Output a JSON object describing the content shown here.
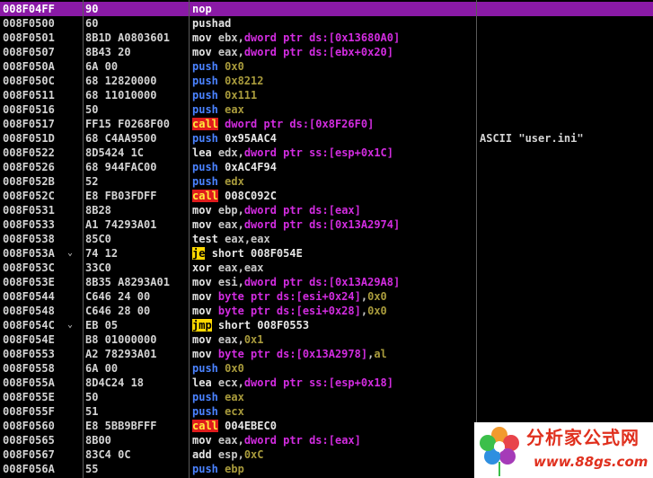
{
  "rows": [
    {
      "addr": "008F04FF",
      "jm": "",
      "hex": "90",
      "dis": [
        [
          "mn",
          "nop"
        ]
      ],
      "comment": "",
      "selected": true
    },
    {
      "addr": "008F0500",
      "jm": "",
      "hex": "60",
      "dis": [
        [
          "mn",
          "pushad"
        ]
      ],
      "comment": ""
    },
    {
      "addr": "008F0501",
      "jm": "",
      "hex": "8B1D A0803601",
      "dis": [
        [
          "mn",
          "mov "
        ],
        [
          "reg",
          "ebx"
        ],
        [
          "sep",
          ","
        ],
        [
          "mem",
          "dword ptr ds:[0x13680A0]"
        ]
      ],
      "comment": ""
    },
    {
      "addr": "008F0507",
      "jm": "",
      "hex": "8B43 20",
      "dis": [
        [
          "mn",
          "mov "
        ],
        [
          "reg",
          "eax"
        ],
        [
          "sep",
          ","
        ],
        [
          "mem",
          "dword ptr ds:[ebx+0x20]"
        ]
      ],
      "comment": ""
    },
    {
      "addr": "008F050A",
      "jm": "",
      "hex": "6A 00",
      "dis": [
        [
          "push",
          "push "
        ],
        [
          "num",
          "0x0"
        ]
      ],
      "comment": ""
    },
    {
      "addr": "008F050C",
      "jm": "",
      "hex": "68 12820000",
      "dis": [
        [
          "push",
          "push "
        ],
        [
          "num",
          "0x8212"
        ]
      ],
      "comment": ""
    },
    {
      "addr": "008F0511",
      "jm": "",
      "hex": "68 11010000",
      "dis": [
        [
          "push",
          "push "
        ],
        [
          "num",
          "0x111"
        ]
      ],
      "comment": ""
    },
    {
      "addr": "008F0516",
      "jm": "",
      "hex": "50",
      "dis": [
        [
          "push",
          "push "
        ],
        [
          "num",
          "eax"
        ]
      ],
      "comment": ""
    },
    {
      "addr": "008F0517",
      "jm": "",
      "hex": "FF15 F0268F00",
      "dis": [
        [
          "call",
          "call"
        ],
        [
          "sep",
          " "
        ],
        [
          "mem",
          "dword ptr ds:[0x8F26F0]"
        ]
      ],
      "comment": ""
    },
    {
      "addr": "008F051D",
      "jm": "",
      "hex": "68 C4AA9500",
      "dis": [
        [
          "push",
          "push "
        ],
        [
          "lbl",
          "0x95AAC4"
        ]
      ],
      "comment": "ASCII \"user.ini\""
    },
    {
      "addr": "008F0522",
      "jm": "",
      "hex": "8D5424 1C",
      "dis": [
        [
          "mn",
          "lea "
        ],
        [
          "reg",
          "edx"
        ],
        [
          "sep",
          ","
        ],
        [
          "mem",
          "dword ptr ss:[esp+0x1C]"
        ]
      ],
      "comment": ""
    },
    {
      "addr": "008F0526",
      "jm": "",
      "hex": "68 944FAC00",
      "dis": [
        [
          "push",
          "push "
        ],
        [
          "lbl",
          "0xAC4F94"
        ]
      ],
      "comment": ""
    },
    {
      "addr": "008F052B",
      "jm": "",
      "hex": "52",
      "dis": [
        [
          "push",
          "push "
        ],
        [
          "num",
          "edx"
        ]
      ],
      "comment": ""
    },
    {
      "addr": "008F052C",
      "jm": "",
      "hex": "E8 FB03FDFF",
      "dis": [
        [
          "call",
          "call"
        ],
        [
          "sep",
          " "
        ],
        [
          "lbl",
          "008C092C"
        ]
      ],
      "comment": ""
    },
    {
      "addr": "008F0531",
      "jm": "",
      "hex": "8B28",
      "dis": [
        [
          "mn",
          "mov "
        ],
        [
          "reg",
          "ebp"
        ],
        [
          "sep",
          ","
        ],
        [
          "mem",
          "dword ptr ds:[eax]"
        ]
      ],
      "comment": ""
    },
    {
      "addr": "008F0533",
      "jm": "",
      "hex": "A1 74293A01",
      "dis": [
        [
          "mn",
          "mov "
        ],
        [
          "reg",
          "eax"
        ],
        [
          "sep",
          ","
        ],
        [
          "mem",
          "dword ptr ds:[0x13A2974]"
        ]
      ],
      "comment": ""
    },
    {
      "addr": "008F0538",
      "jm": "",
      "hex": "85C0",
      "dis": [
        [
          "mn",
          "test "
        ],
        [
          "reg",
          "eax"
        ],
        [
          "sep",
          ","
        ],
        [
          "reg",
          "eax"
        ]
      ],
      "comment": ""
    },
    {
      "addr": "008F053A",
      "jm": "⌄",
      "hex": "74 12",
      "dis": [
        [
          "jmp",
          "je"
        ],
        [
          "sep",
          " "
        ],
        [
          "lbl",
          "short 008F054E"
        ]
      ],
      "comment": ""
    },
    {
      "addr": "008F053C",
      "jm": "",
      "hex": "33C0",
      "dis": [
        [
          "mn",
          "xor "
        ],
        [
          "reg",
          "eax"
        ],
        [
          "sep",
          ","
        ],
        [
          "reg",
          "eax"
        ]
      ],
      "comment": ""
    },
    {
      "addr": "008F053E",
      "jm": "",
      "hex": "8B35 A8293A01",
      "dis": [
        [
          "mn",
          "mov "
        ],
        [
          "reg",
          "esi"
        ],
        [
          "sep",
          ","
        ],
        [
          "mem",
          "dword ptr ds:[0x13A29A8]"
        ]
      ],
      "comment": ""
    },
    {
      "addr": "008F0544",
      "jm": "",
      "hex": "C646 24 00",
      "dis": [
        [
          "mn",
          "mov "
        ],
        [
          "mem",
          "byte ptr ds:[esi+0x24]"
        ],
        [
          "sep",
          ","
        ],
        [
          "num",
          "0x0"
        ]
      ],
      "comment": ""
    },
    {
      "addr": "008F0548",
      "jm": "",
      "hex": "C646 28 00",
      "dis": [
        [
          "mn",
          "mov "
        ],
        [
          "mem",
          "byte ptr ds:[esi+0x28]"
        ],
        [
          "sep",
          ","
        ],
        [
          "num",
          "0x0"
        ]
      ],
      "comment": ""
    },
    {
      "addr": "008F054C",
      "jm": "⌄",
      "hex": "EB 05",
      "dis": [
        [
          "jmp",
          "jmp"
        ],
        [
          "sep",
          " "
        ],
        [
          "lbl",
          "short 008F0553"
        ]
      ],
      "comment": ""
    },
    {
      "addr": "008F054E",
      "jm": "",
      "hex": "B8 01000000",
      "dis": [
        [
          "mn",
          "mov "
        ],
        [
          "reg",
          "eax"
        ],
        [
          "sep",
          ","
        ],
        [
          "num",
          "0x1"
        ]
      ],
      "comment": ""
    },
    {
      "addr": "008F0553",
      "jm": "",
      "hex": "A2 78293A01",
      "dis": [
        [
          "mn",
          "mov "
        ],
        [
          "mem",
          "byte ptr ds:[0x13A2978]"
        ],
        [
          "sep",
          ","
        ],
        [
          "num",
          "al"
        ]
      ],
      "comment": ""
    },
    {
      "addr": "008F0558",
      "jm": "",
      "hex": "6A 00",
      "dis": [
        [
          "push",
          "push "
        ],
        [
          "num",
          "0x0"
        ]
      ],
      "comment": ""
    },
    {
      "addr": "008F055A",
      "jm": "",
      "hex": "8D4C24 18",
      "dis": [
        [
          "mn",
          "lea "
        ],
        [
          "reg",
          "ecx"
        ],
        [
          "sep",
          ","
        ],
        [
          "mem",
          "dword ptr ss:[esp+0x18]"
        ]
      ],
      "comment": ""
    },
    {
      "addr": "008F055E",
      "jm": "",
      "hex": "50",
      "dis": [
        [
          "push",
          "push "
        ],
        [
          "num",
          "eax"
        ]
      ],
      "comment": ""
    },
    {
      "addr": "008F055F",
      "jm": "",
      "hex": "51",
      "dis": [
        [
          "push",
          "push "
        ],
        [
          "num",
          "ecx"
        ]
      ],
      "comment": ""
    },
    {
      "addr": "008F0560",
      "jm": "",
      "hex": "E8 5BB9BFFF",
      "dis": [
        [
          "call",
          "call"
        ],
        [
          "sep",
          " "
        ],
        [
          "lbl",
          "004EBEC0"
        ]
      ],
      "comment": ""
    },
    {
      "addr": "008F0565",
      "jm": "",
      "hex": "8B00",
      "dis": [
        [
          "mn",
          "mov "
        ],
        [
          "reg",
          "eax"
        ],
        [
          "sep",
          ","
        ],
        [
          "mem",
          "dword ptr ds:[eax]"
        ]
      ],
      "comment": ""
    },
    {
      "addr": "008F0567",
      "jm": "",
      "hex": "83C4 0C",
      "dis": [
        [
          "mn",
          "add "
        ],
        [
          "reg",
          "esp"
        ],
        [
          "sep",
          ","
        ],
        [
          "num",
          "0xC"
        ]
      ],
      "comment": ""
    },
    {
      "addr": "008F056A",
      "jm": "",
      "hex": "55",
      "dis": [
        [
          "push",
          "push "
        ],
        [
          "num",
          "ebp"
        ]
      ],
      "comment": ""
    }
  ],
  "watermark": {
    "cn": "分析家公式网",
    "url": "www.88gs.com"
  },
  "colors": {
    "selection": "#8a1aa6",
    "memory_operand": "#d22ce0",
    "push": "#4a82ff",
    "immediate": "#a99b3c",
    "call_highlight": "#e01c1c",
    "jump_highlight": "#ffd800"
  }
}
